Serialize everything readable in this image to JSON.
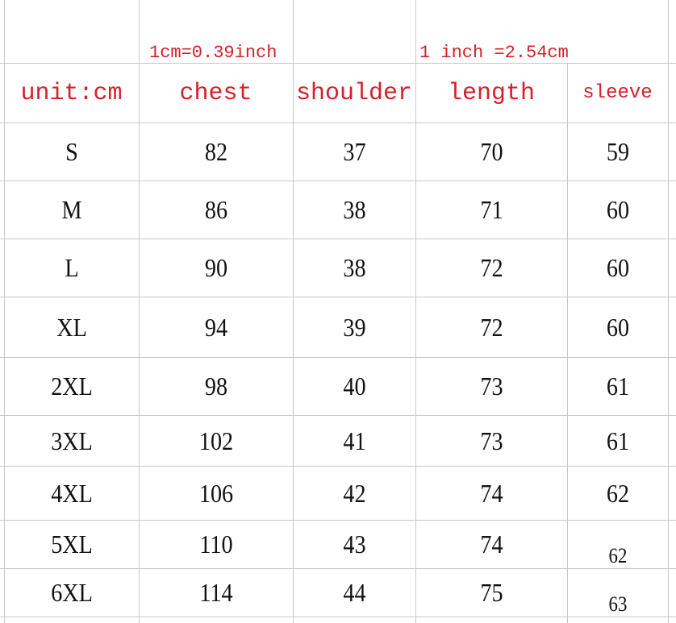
{
  "notes": {
    "cm_to_inch": "1cm=0.39inch",
    "inch_to_cm": "1 inch =2.54cm"
  },
  "header": {
    "unit": "unit:cm",
    "columns": [
      "chest",
      "shoulder",
      "length",
      "sleeve"
    ]
  },
  "colors": {
    "header_text": "#d6202a",
    "body_text": "#111111",
    "grid": "#c8c8c8"
  },
  "rows": [
    {
      "size": "S",
      "chest": "82",
      "shoulder": "37",
      "length": "70",
      "sleeve": "59"
    },
    {
      "size": "M",
      "chest": "86",
      "shoulder": "38",
      "length": "71",
      "sleeve": "60"
    },
    {
      "size": "L",
      "chest": "90",
      "shoulder": "38",
      "length": "72",
      "sleeve": "60"
    },
    {
      "size": "XL",
      "chest": "94",
      "shoulder": "39",
      "length": "72",
      "sleeve": "60"
    },
    {
      "size": "2XL",
      "chest": "98",
      "shoulder": "40",
      "length": "73",
      "sleeve": "61"
    },
    {
      "size": "3XL",
      "chest": "102",
      "shoulder": "41",
      "length": "73",
      "sleeve": "61"
    },
    {
      "size": "4XL",
      "chest": "106",
      "shoulder": "42",
      "length": "74",
      "sleeve": "62"
    },
    {
      "size": "5XL",
      "chest": "110",
      "shoulder": "43",
      "length": "74",
      "sleeve": "62"
    },
    {
      "size": "6XL",
      "chest": "114",
      "shoulder": "44",
      "length": "75",
      "sleeve": "63"
    }
  ]
}
